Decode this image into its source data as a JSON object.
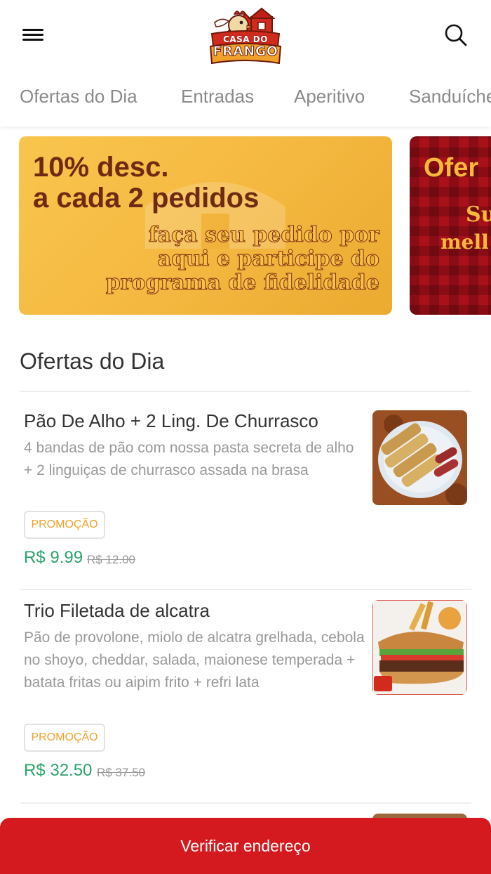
{
  "header": {
    "logo_line1": "CASA DO",
    "logo_line2": "FRANGO",
    "menu_icon": "hamburger-menu-icon",
    "search_icon": "search-icon"
  },
  "tabs": [
    {
      "label": "Ofertas do Dia"
    },
    {
      "label": "Entradas"
    },
    {
      "label": "Aperitivo"
    },
    {
      "label": "Sanduíches"
    }
  ],
  "banners": [
    {
      "line1": "10% desc.",
      "line2": "a cada 2 pedidos",
      "sub1": "faça seu pedido por",
      "sub2": "aqui e participe do",
      "sub3": "programa de fidelidade"
    },
    {
      "line1": "Ofer",
      "line2": "Su",
      "line3": "mell"
    }
  ],
  "section": {
    "title": "Ofertas do Dia"
  },
  "items": [
    {
      "title": "Pão De Alho + 2 Ling. De Churrasco",
      "description": "4 bandas de pão com nossa pasta secreta de alho + 2 linguiças de churrasco assada na brasa",
      "badge": "PROMOÇÃO",
      "price": "R$ 9.99",
      "old_price": "R$ 12.00"
    },
    {
      "title": "Trio Filetada de alcatra",
      "description": "Pão de provolone, miolo de alcatra grelhada, cebola no shoyo, cheddar, salada, maionese temperada + batata fritas ou aipim frito + refri lata",
      "badge": "PROMOÇÃO",
      "price": "R$ 32.50",
      "old_price": "R$ 37.50"
    }
  ],
  "cta": {
    "label": "Verificar endereço"
  },
  "colors": {
    "accent_red": "#d41a1e",
    "price_green": "#2aa56a",
    "badge_orange": "#f0a12a",
    "banner_yellow": "#f5b941"
  }
}
